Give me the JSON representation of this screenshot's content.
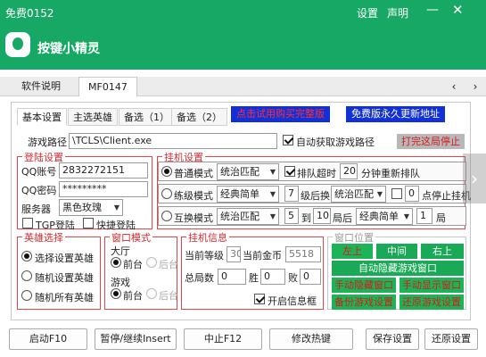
{
  "window": {
    "title": "免费0152",
    "settings_label": "设置",
    "statement_label": "声明",
    "app_name": "按键小精灵"
  },
  "top_tabs": [
    "软件说明",
    "MF0147"
  ],
  "sub_tabs": [
    "基本设置",
    "主选英雄",
    "备选（1）",
    "备选（2）"
  ],
  "banners": {
    "buy": "点击试用购买完整版",
    "free": "免费版永久更新地址"
  },
  "game_path": {
    "label": "游戏路径",
    "value": "\\TCLS\\Client.exe",
    "auto_label": "自动获取游戏路径",
    "auto_checked": true,
    "stop_button": "打完这局停止"
  },
  "login": {
    "title": "登陆设置",
    "qq_label": "QQ账号",
    "qq_value": "2832272151",
    "pwd_label": "QQ密码",
    "pwd_value": "*********",
    "server_label": "服务器",
    "server_value": "黑色玫瑰",
    "tgp_label": "TGP登陆",
    "quick_label": "快捷登陆"
  },
  "hangup": {
    "title": "挂机设置",
    "row1": {
      "mode": "普通模式",
      "select": "统治匹配",
      "timeout_label": "排队超时",
      "timeout_value": "20",
      "requeue_label": "分钟重新排队"
    },
    "row2": {
      "mode": "练级模式",
      "select": "经典简单",
      "level": "7",
      "after_label": "级后换",
      "select2": "统治匹配",
      "stop_value": "0",
      "stop_label": "点停止挂机"
    },
    "row3": {
      "mode": "互换模式",
      "select": "统治匹配",
      "from": "5",
      "to_label": "到",
      "to": "10",
      "after_label": "局后",
      "select2": "经典简单",
      "count": "1",
      "count_label": "局"
    }
  },
  "hero": {
    "title": "英雄选择",
    "options": [
      "选择设置英雄",
      "随机设置英雄",
      "随机所有英雄"
    ]
  },
  "window_mode": {
    "title": "窗口模式",
    "hall_label": "大厅",
    "game_label": "游戏",
    "front": "前台",
    "back": "后台"
  },
  "info": {
    "title": "挂机信息",
    "level_label": "当前等级",
    "level_value": "30",
    "gold_label": "当前金币",
    "gold_value": "5518",
    "total_label": "总局数",
    "total_value": "0",
    "win_label": "胜",
    "win_value": "0",
    "lose_label": "败",
    "lose_value": "0",
    "open_info_label": "开启信息框"
  },
  "window_pos": {
    "title": "窗口位置",
    "left": "左上",
    "center": "中间",
    "right": "右上",
    "auto_hide": "自动隐藏游戏窗口",
    "manual_hide": "手动隐藏窗口",
    "manual_show": "手动显示窗口",
    "backup": "备份游戏设置",
    "restore": "还原游戏设置"
  },
  "bottom_buttons": {
    "start": "启动F10",
    "pause": "暂停/继续Insert",
    "stop": "中止F12",
    "hotkey": "修改热键",
    "save": "保存设置",
    "restore": "还原设置"
  },
  "colors": {
    "brand_green": "#18a865",
    "group_red": "#e8434a",
    "banner_blue": "#1230d8",
    "button_green": "#19a957"
  }
}
